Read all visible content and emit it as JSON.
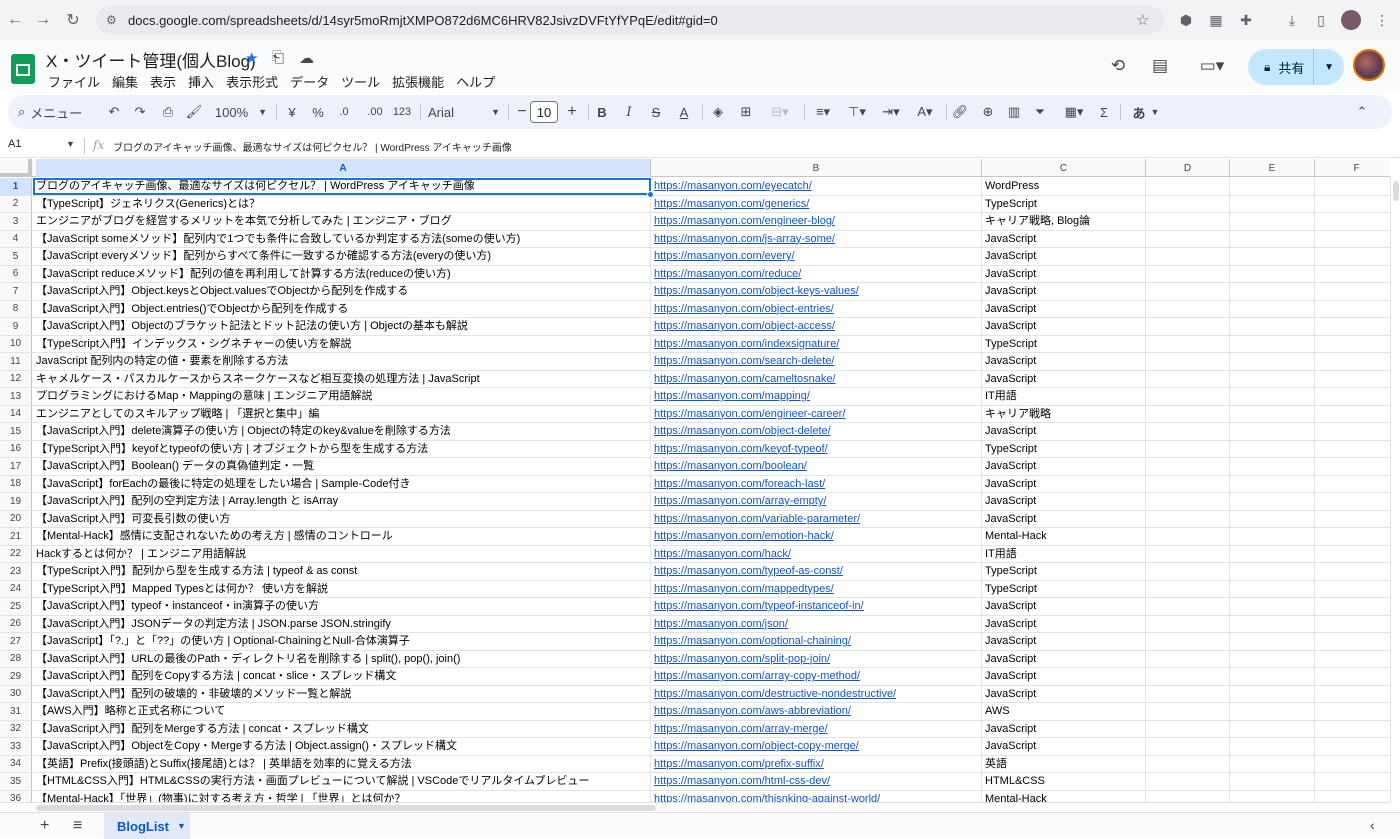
{
  "browser": {
    "url": "docs.google.com/spreadsheets/d/14syr5moRmjtXMPO872d6MC6HRV82JsivzDVFtYfYPqE/edit#gid=0",
    "back_icon": "arrow-left-icon",
    "forward_icon": "arrow-right-icon",
    "reload_icon": "reload-icon"
  },
  "doc": {
    "title": "X・ツイート管理(個人Blog)",
    "menu": [
      "ファイル",
      "編集",
      "表示",
      "挿入",
      "表示形式",
      "データ",
      "ツール",
      "拡張機能",
      "ヘルプ"
    ],
    "share_label": "共有"
  },
  "toolbar": {
    "search_label": "メニュー",
    "zoom": "100%",
    "currency": "¥",
    "percent": "%",
    "decrease_decimals": ".0",
    "increase_decimals": ".00",
    "number_format": "123",
    "font": "Arial",
    "font_size": "10",
    "input_tool": "あ"
  },
  "formula_bar": {
    "cell_ref": "A1",
    "fx": "fx",
    "content": "ブログのアイキャッチ画像、最適なサイズは何ピクセル？ | WordPress アイキャッチ画像"
  },
  "columns": [
    "A",
    "B",
    "C",
    "D",
    "E",
    "F"
  ],
  "rows": [
    {
      "n": "1",
      "a": "ブログのアイキャッチ画像、最適なサイズは何ピクセル？ | WordPress アイキャッチ画像",
      "b": "https://masanyon.com/eyecatch/",
      "c": "WordPress"
    },
    {
      "n": "2",
      "a": "【TypeScript】ジェネリクス(Generics)とは？",
      "b": "https://masanyon.com/generics/",
      "c": "TypeScript"
    },
    {
      "n": "3",
      "a": "エンジニアがブログを経営するメリットを本気で分析してみた | エンジニア・ブログ",
      "b": "https://masanyon.com/engineer-blog/",
      "c": "キャリア戦略, Blog論"
    },
    {
      "n": "4",
      "a": "【JavaScript someメソッド】配列内で1つでも条件に合致しているか判定する方法(someの使い方)",
      "b": "https://masanyon.com/js-array-some/",
      "c": "JavaScript"
    },
    {
      "n": "5",
      "a": "【JavaScript everyメソッド】配列からすべて条件に一致するか確認する方法(everyの使い方)",
      "b": "https://masanyon.com/every/",
      "c": "JavaScript"
    },
    {
      "n": "6",
      "a": "【JavaScript reduceメソッド】配列の値を再利用して計算する方法(reduceの使い方)",
      "b": "https://masanyon.com/reduce/",
      "c": "JavaScript"
    },
    {
      "n": "7",
      "a": "【JavaScript入門】Object.keysとObject.valuesでObjectから配列を作成する",
      "b": "https://masanyon.com/object-keys-values/",
      "c": "JavaScript"
    },
    {
      "n": "8",
      "a": "【JavaScript入門】Object.entries()でObjectから配列を作成する",
      "b": "https://masanyon.com/object-entries/",
      "c": "JavaScript"
    },
    {
      "n": "9",
      "a": "【JavaScript入門】Objectのブラケット記法とドット記法の使い方 | Objectの基本も解説",
      "b": "https://masanyon.com/object-access/",
      "c": "JavaScript"
    },
    {
      "n": "10",
      "a": "【TypeScript入門】インデックス・シグネチャーの使い方を解説",
      "b": "https://masanyon.com/indexsignature/",
      "c": "TypeScript"
    },
    {
      "n": "11",
      "a": "JavaScript 配列内の特定の値・要素を削除する方法",
      "b": "https://masanyon.com/search-delete/",
      "c": "JavaScript"
    },
    {
      "n": "12",
      "a": "キャメルケース・パスカルケースからスネークケースなど相互変換の処理方法 | JavaScript",
      "b": "https://masanyon.com/cameltosnake/",
      "c": "JavaScript"
    },
    {
      "n": "13",
      "a": "プログラミングにおけるMap・Mappingの意味 | エンジニア用語解説",
      "b": "https://masanyon.com/mapping/",
      "c": "IT用語"
    },
    {
      "n": "14",
      "a": "エンジニアとしてのスキルアップ戦略 | 「選択と集中」編",
      "b": "https://masanyon.com/engineer-career/",
      "c": "キャリア戦略"
    },
    {
      "n": "15",
      "a": "【JavaScript入門】delete演算子の使い方 | Objectの特定のkey&valueを削除する方法",
      "b": "https://masanyon.com/object-delete/",
      "c": "JavaScript"
    },
    {
      "n": "16",
      "a": "【TypeScript入門】keyofとtypeofの使い方 | オブジェクトから型を生成する方法",
      "b": "https://masanyon.com/keyof-typeof/",
      "c": "TypeScript"
    },
    {
      "n": "17",
      "a": "【JavaScript入門】Boolean() データの真偽値判定・一覧",
      "b": "https://masanyon.com/boolean/",
      "c": "JavaScript"
    },
    {
      "n": "18",
      "a": "【JavaScript】forEachの最後に特定の処理をしたい場合 | Sample-Code付き",
      "b": "https://masanyon.com/foreach-last/",
      "c": "JavaScript"
    },
    {
      "n": "19",
      "a": "【JavaScript入門】配列の空判定方法 | Array.length と isArray",
      "b": "https://masanyon.com/array-empty/",
      "c": "JavaScript"
    },
    {
      "n": "20",
      "a": "【JavaScript入門】可変長引数の使い方",
      "b": "https://masanyon.com/variable-parameter/",
      "c": "JavaScript"
    },
    {
      "n": "21",
      "a": "【Mental-Hack】感情に支配されないための考え方 | 感情のコントロール",
      "b": "https://masanyon.com/emotion-hack/",
      "c": "Mental-Hack"
    },
    {
      "n": "22",
      "a": "Hackするとは何か？ | エンジニア用語解説",
      "b": "https://masanyon.com/hack/",
      "c": "IT用語"
    },
    {
      "n": "23",
      "a": "【TypeScript入門】配列から型を生成する方法 | typeof & as const",
      "b": "https://masanyon.com/typeof-as-const/",
      "c": "TypeScript"
    },
    {
      "n": "24",
      "a": "【TypeScript入門】Mapped Typesとは何か？ 使い方を解説",
      "b": "https://masanyon.com/mappedtypes/",
      "c": "TypeScript"
    },
    {
      "n": "25",
      "a": "【JavaScript入門】typeof・instanceof・in演算子の使い方",
      "b": "https://masanyon.com/typeof-instanceof-in/",
      "c": "JavaScript"
    },
    {
      "n": "26",
      "a": "【JavaScript入門】JSONデータの判定方法 | JSON.parse JSON.stringify",
      "b": "https://masanyon.com/json/",
      "c": "JavaScript"
    },
    {
      "n": "27",
      "a": "【JavaScript】「?.」と「??」の使い方 | Optional-ChainingとNull-合体演算子",
      "b": "https://masanyon.com/optional-chaining/",
      "c": "JavaScript"
    },
    {
      "n": "28",
      "a": "【JavaScript入門】URLの最後のPath・ディレクトリ名を削除する | split(), pop(), join()",
      "b": "https://masanyon.com/split-pop-join/",
      "c": "JavaScript"
    },
    {
      "n": "29",
      "a": "【JavaScript入門】配列をCopyする方法 | concat・slice・スプレッド構文",
      "b": "https://masanyon.com/array-copy-method/",
      "c": "JavaScript"
    },
    {
      "n": "30",
      "a": "【JavaScript入門】配列の破壊的・非破壊的メソッド一覧と解説",
      "b": "https://masanyon.com/destructive-nondestructive/",
      "c": "JavaScript"
    },
    {
      "n": "31",
      "a": "【AWS入門】略称と正式名称について",
      "b": "https://masanyon.com/aws-abbreviation/",
      "c": "AWS"
    },
    {
      "n": "32",
      "a": "【JavaScript入門】配列をMergeする方法 | concat・スプレッド構文",
      "b": "https://masanyon.com/array-merge/",
      "c": "JavaScript"
    },
    {
      "n": "33",
      "a": "【JavaScript入門】ObjectをCopy・Mergeする方法 | Object.assign()・スプレッド構文",
      "b": "https://masanyon.com/object-copy-merge/",
      "c": "JavaScript"
    },
    {
      "n": "34",
      "a": "【英語】Prefix(接頭語)とSuffix(接尾語)とは？ | 英単語を効率的に覚える方法",
      "b": "https://masanyon.com/prefix-suffix/",
      "c": "英語"
    },
    {
      "n": "35",
      "a": "【HTML&CSS入門】HTML&CSSの実行方法・画面プレビューについて解説 | VSCodeでリアルタイムプレビュー",
      "b": "https://masanyon.com/html-css-dev/",
      "c": "HTML&CSS"
    },
    {
      "n": "36",
      "a": "【Mental-Hack】「世界」(物事)に対する考え方・哲学 | 「世界」とは何か？",
      "b": "https://masanyon.com/thisnking-against-world/",
      "c": "Mental-Hack"
    }
  ],
  "sheet_tabs": [
    {
      "label": "BlogList"
    }
  ]
}
